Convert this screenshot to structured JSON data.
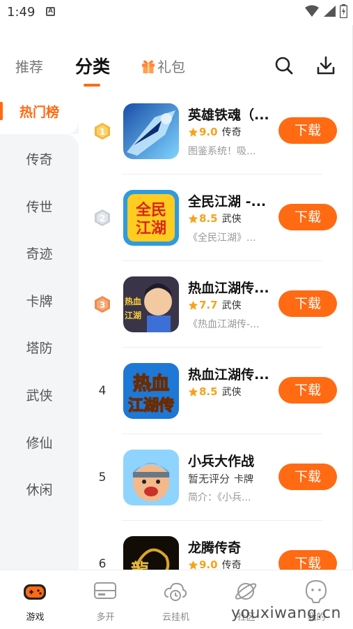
{
  "status_bar": {
    "time": "1:49",
    "notification_glyph": "A"
  },
  "top_tabs": {
    "recommend": "推荐",
    "category": "分类",
    "gift": "礼包"
  },
  "side_nav": {
    "active": "热门榜",
    "items": [
      "传奇",
      "传世",
      "奇迹",
      "卡牌",
      "塔防",
      "武侠",
      "修仙",
      "休闲"
    ]
  },
  "games": [
    {
      "rank": "1",
      "name": "英雄铁魂（...",
      "score": "9.0",
      "tag": "传奇",
      "desc": "图鉴系统！吸...",
      "button": "下载"
    },
    {
      "rank": "2",
      "name": "全民江湖 -...",
      "score": "8.5",
      "tag": "武侠",
      "desc": "《全民江湖》...",
      "button": "下载"
    },
    {
      "rank": "3",
      "name": "热血江湖传...",
      "score": "7.7",
      "tag": "武侠",
      "desc": "《热血江湖传-...",
      "button": "下载"
    },
    {
      "rank": "4",
      "name": "热血江湖传...",
      "score": "8.5",
      "tag": "武侠",
      "desc": "",
      "button": "下载"
    },
    {
      "rank": "5",
      "name": "小兵大作战",
      "score_text": "暂无评分",
      "tag": "卡牌",
      "desc": "简介：《小兵...",
      "button": "下载"
    },
    {
      "rank": "6",
      "name": "龙腾传奇",
      "score": "9.0",
      "tag": "传奇",
      "desc": "",
      "button": "下载"
    }
  ],
  "bottom_nav": {
    "items": [
      "游戏",
      "多开",
      "云挂机",
      "社区",
      "我的"
    ],
    "active_index": 0
  },
  "watermark": "youxiwang.cn",
  "colors": {
    "accent": "#ff6a13",
    "score": "#f7a21b",
    "gold": "#f5b53a",
    "silver": "#c9ced6",
    "bronze": "#ef8a4c"
  }
}
